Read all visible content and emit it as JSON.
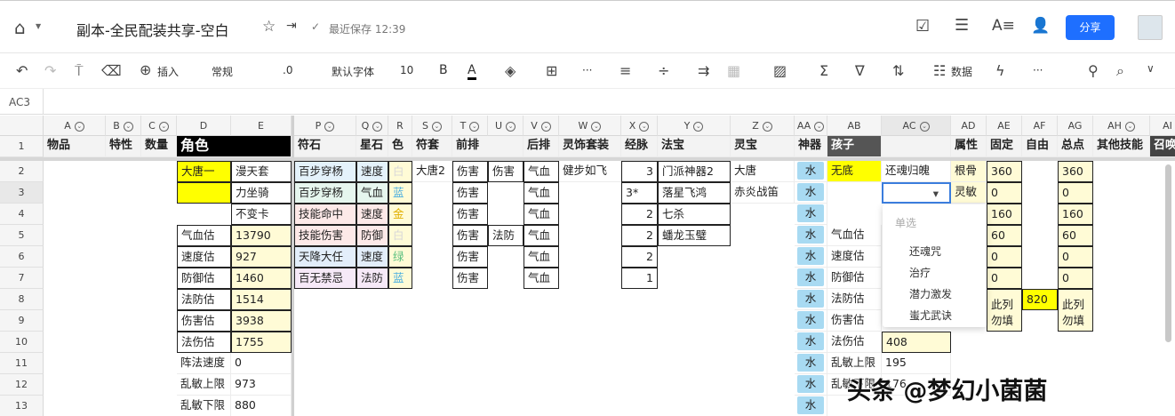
{
  "header": {
    "title": "副本-全民配装共享-空白",
    "save_status": "最近保存 12:39",
    "share_label": "分享"
  },
  "toolbar": {
    "insert": "插入",
    "format": "常规",
    "decimal": ".0",
    "font": "默认字体",
    "size": "10",
    "bold": "B",
    "font_color": "A",
    "data": "数据",
    "more": "···"
  },
  "formula_bar": {
    "cell_ref": "AC3",
    "value": ""
  },
  "colors": {
    "accent": "#1e6fff",
    "yellow": "#ffff00",
    "light_yellow": "#fffbd6",
    "water": "#a8daf2"
  },
  "columns": [
    {
      "id": "A",
      "f": true
    },
    {
      "id": "B",
      "f": true
    },
    {
      "id": "C",
      "f": true
    },
    {
      "id": "D",
      "f": false
    },
    {
      "id": "E",
      "f": false
    },
    {
      "id": "P",
      "f": true
    },
    {
      "id": "Q",
      "f": true
    },
    {
      "id": "R",
      "f": false
    },
    {
      "id": "S",
      "f": true
    },
    {
      "id": "T",
      "f": true
    },
    {
      "id": "U",
      "f": true
    },
    {
      "id": "V",
      "f": true
    },
    {
      "id": "W",
      "f": true
    },
    {
      "id": "X",
      "f": true
    },
    {
      "id": "Y",
      "f": true
    },
    {
      "id": "Z",
      "f": true
    },
    {
      "id": "AA",
      "f": true
    },
    {
      "id": "AB",
      "f": false
    },
    {
      "id": "AC",
      "f": true
    },
    {
      "id": "AD",
      "f": false
    },
    {
      "id": "AE",
      "f": false
    },
    {
      "id": "AF",
      "f": false
    },
    {
      "id": "AG",
      "f": false
    },
    {
      "id": "AH",
      "f": true
    },
    {
      "id": "AI",
      "f": false
    }
  ],
  "rows": [
    "1",
    "2",
    "3",
    "4",
    "5",
    "6",
    "7",
    "8",
    "9",
    "10",
    "11",
    "12",
    "13"
  ],
  "cells": [
    {
      "r": 1,
      "c": "A",
      "v": "物品",
      "t": "hdr"
    },
    {
      "r": 1,
      "c": "B",
      "v": "特性",
      "t": "hdr"
    },
    {
      "r": 1,
      "c": "C",
      "v": "数量",
      "t": "hdr"
    },
    {
      "r": 1,
      "c": "D",
      "v": "角色",
      "t": "hdr",
      "span": 2,
      "bg": "#000000",
      "fg": "#ffffff"
    },
    {
      "r": 1,
      "c": "P",
      "v": "符石",
      "t": "hdr"
    },
    {
      "r": 1,
      "c": "Q",
      "v": "星石",
      "t": "hdr"
    },
    {
      "r": 1,
      "c": "R",
      "v": "色",
      "t": "hdr"
    },
    {
      "r": 1,
      "c": "S",
      "v": "符套",
      "t": "hdr"
    },
    {
      "r": 1,
      "c": "T",
      "v": "前排",
      "t": "hdr",
      "span": 2
    },
    {
      "r": 1,
      "c": "V",
      "v": "后排",
      "t": "hdr"
    },
    {
      "r": 1,
      "c": "W",
      "v": "灵饰套装",
      "t": "hdr"
    },
    {
      "r": 1,
      "c": "X",
      "v": "经脉",
      "t": "hdr"
    },
    {
      "r": 1,
      "c": "Y",
      "v": "法宝",
      "t": "hdr"
    },
    {
      "r": 1,
      "c": "Z",
      "v": "灵宝",
      "t": "hdr"
    },
    {
      "r": 1,
      "c": "AA",
      "v": "神器",
      "t": "hdr"
    },
    {
      "r": 1,
      "c": "AB",
      "v": "孩子",
      "t": "hdr",
      "bg": "#555555",
      "fg": "#ffffff"
    },
    {
      "r": 1,
      "c": "AC",
      "v": "",
      "t": "hdr"
    },
    {
      "r": 1,
      "c": "AD",
      "v": "属性",
      "t": "hdr"
    },
    {
      "r": 1,
      "c": "AE",
      "v": "固定",
      "t": "hdr"
    },
    {
      "r": 1,
      "c": "AF",
      "v": "自由",
      "t": "hdr"
    },
    {
      "r": 1,
      "c": "AG",
      "v": "总点",
      "t": "hdr"
    },
    {
      "r": 1,
      "c": "AH",
      "v": "其他技能",
      "t": "hdr"
    },
    {
      "r": 1,
      "c": "AI",
      "v": "召唤",
      "t": "hdr",
      "bg": "#444444",
      "fg": "#ffffff"
    },
    {
      "r": 2,
      "c": "D",
      "v": "大唐一",
      "bg": "#ffff00",
      "b": 1
    },
    {
      "r": 2,
      "c": "E",
      "v": "漫天套",
      "b": 1
    },
    {
      "r": 2,
      "c": "P",
      "v": "百步穿杨",
      "bg": "#e4f2fb",
      "b": 1
    },
    {
      "r": 2,
      "c": "Q",
      "v": "速度",
      "bg": "#e4f2fb",
      "b": 1
    },
    {
      "r": 2,
      "c": "R",
      "v": "白",
      "bg": "#fffbd6",
      "fg": "#d8d8d8",
      "b": 1
    },
    {
      "r": 2,
      "c": "S",
      "v": "大唐2"
    },
    {
      "r": 2,
      "c": "T",
      "v": "伤害",
      "b": 1
    },
    {
      "r": 2,
      "c": "U",
      "v": "伤害",
      "b": 1
    },
    {
      "r": 2,
      "c": "V",
      "v": "气血",
      "b": 1
    },
    {
      "r": 2,
      "c": "W",
      "v": "健步如飞"
    },
    {
      "r": 2,
      "c": "X",
      "v": "3",
      "t": "right",
      "b": 1
    },
    {
      "r": 2,
      "c": "Y",
      "v": "门派神器2",
      "b": 1
    },
    {
      "r": 2,
      "c": "Z",
      "v": "大唐"
    },
    {
      "r": 2,
      "c": "AA",
      "v": "水",
      "t": "water"
    },
    {
      "r": 2,
      "c": "AB",
      "v": "无底",
      "bg": "#ffff00"
    },
    {
      "r": 2,
      "c": "AC",
      "v": "还魂归魄"
    },
    {
      "r": 2,
      "c": "AD",
      "v": "根骨",
      "bg": "#fffbd6"
    },
    {
      "r": 2,
      "c": "AE",
      "v": "360",
      "bg": "#fffbd6",
      "b": 1
    },
    {
      "r": 2,
      "c": "AG",
      "v": "360",
      "bg": "#fffbd6",
      "b": 1
    },
    {
      "r": 3,
      "c": "D",
      "v": "",
      "bg": "#ffff00",
      "b": 1
    },
    {
      "r": 3,
      "c": "E",
      "v": "力坐骑",
      "b": 1
    },
    {
      "r": 3,
      "c": "P",
      "v": "百步穿杨",
      "bg": "#e6f6ee",
      "b": 1
    },
    {
      "r": 3,
      "c": "Q",
      "v": "气血",
      "bg": "#e6f6ee",
      "b": 1
    },
    {
      "r": 3,
      "c": "R",
      "v": "蓝",
      "bg": "#fffbd6",
      "fg": "#4aaee0",
      "b": 1
    },
    {
      "r": 3,
      "c": "T",
      "v": "伤害",
      "b": 1
    },
    {
      "r": 3,
      "c": "V",
      "v": "气血",
      "b": 1
    },
    {
      "r": 3,
      "c": "X",
      "v": "3*",
      "b": 1
    },
    {
      "r": 3,
      "c": "Y",
      "v": "落星飞鸿",
      "b": 1
    },
    {
      "r": 3,
      "c": "Z",
      "v": "赤炎战笛"
    },
    {
      "r": 3,
      "c": "AA",
      "v": "水",
      "t": "water"
    },
    {
      "r": 3,
      "c": "AC",
      "v": "",
      "t": "selected"
    },
    {
      "r": 3,
      "c": "AD",
      "v": "灵敏",
      "bg": "#fffbd6"
    },
    {
      "r": 3,
      "c": "AE",
      "v": "0",
      "bg": "#fffbd6",
      "b": 1
    },
    {
      "r": 3,
      "c": "AG",
      "v": "0",
      "bg": "#fffbd6",
      "b": 1
    },
    {
      "r": 4,
      "c": "E",
      "v": "不变卡",
      "b": 1
    },
    {
      "r": 4,
      "c": "P",
      "v": "技能命中",
      "bg": "#fde9e8",
      "b": 1
    },
    {
      "r": 4,
      "c": "Q",
      "v": "速度",
      "bg": "#fde9e8",
      "b": 1
    },
    {
      "r": 4,
      "c": "R",
      "v": "金",
      "bg": "#fffbd6",
      "fg": "#e0b000",
      "b": 1
    },
    {
      "r": 4,
      "c": "T",
      "v": "伤害",
      "b": 1
    },
    {
      "r": 4,
      "c": "V",
      "v": "气血",
      "b": 1
    },
    {
      "r": 4,
      "c": "X",
      "v": "2",
      "t": "right",
      "b": 1
    },
    {
      "r": 4,
      "c": "Y",
      "v": "七杀",
      "b": 1
    },
    {
      "r": 4,
      "c": "AA",
      "v": "水",
      "t": "water"
    },
    {
      "r": 4,
      "c": "AE",
      "v": "160",
      "bg": "#fffbd6",
      "b": 1
    },
    {
      "r": 4,
      "c": "AG",
      "v": "160",
      "bg": "#fffbd6",
      "b": 1
    },
    {
      "r": 5,
      "c": "D",
      "v": "气血估",
      "b": 1
    },
    {
      "r": 5,
      "c": "E",
      "v": "13790",
      "bg": "#fffbd6",
      "b": 1
    },
    {
      "r": 5,
      "c": "P",
      "v": "技能伤害",
      "bg": "#fde9e8",
      "b": 1
    },
    {
      "r": 5,
      "c": "Q",
      "v": "防御",
      "bg": "#fde9e8",
      "b": 1
    },
    {
      "r": 5,
      "c": "R",
      "v": "白",
      "bg": "#fffbd6",
      "fg": "#d8d8d8",
      "b": 1
    },
    {
      "r": 5,
      "c": "T",
      "v": "伤害",
      "b": 1
    },
    {
      "r": 5,
      "c": "U",
      "v": "法防",
      "b": 1
    },
    {
      "r": 5,
      "c": "V",
      "v": "气血",
      "b": 1
    },
    {
      "r": 5,
      "c": "X",
      "v": "2",
      "t": "right",
      "b": 1
    },
    {
      "r": 5,
      "c": "Y",
      "v": "蟠龙玉璧",
      "b": 1
    },
    {
      "r": 5,
      "c": "AA",
      "v": "水",
      "t": "water"
    },
    {
      "r": 5,
      "c": "AB",
      "v": "气血估"
    },
    {
      "r": 5,
      "c": "AE",
      "v": "60",
      "bg": "#fffbd6",
      "b": 1
    },
    {
      "r": 5,
      "c": "AG",
      "v": "60",
      "bg": "#fffbd6",
      "b": 1
    },
    {
      "r": 6,
      "c": "D",
      "v": "速度估",
      "b": 1
    },
    {
      "r": 6,
      "c": "E",
      "v": "927",
      "bg": "#fffbd6",
      "b": 1
    },
    {
      "r": 6,
      "c": "P",
      "v": "天降大任",
      "bg": "#e3eefa",
      "b": 1
    },
    {
      "r": 6,
      "c": "Q",
      "v": "速度",
      "bg": "#e3eefa",
      "b": 1
    },
    {
      "r": 6,
      "c": "R",
      "v": "绿",
      "bg": "#fffbd6",
      "fg": "#5cc080",
      "b": 1
    },
    {
      "r": 6,
      "c": "T",
      "v": "伤害",
      "b": 1
    },
    {
      "r": 6,
      "c": "V",
      "v": "气血",
      "b": 1
    },
    {
      "r": 6,
      "c": "X",
      "v": "2",
      "t": "right",
      "b": 1
    },
    {
      "r": 6,
      "c": "AA",
      "v": "水",
      "t": "water"
    },
    {
      "r": 6,
      "c": "AB",
      "v": "速度估"
    },
    {
      "r": 6,
      "c": "AE",
      "v": "0",
      "bg": "#fffbd6",
      "b": 1
    },
    {
      "r": 6,
      "c": "AG",
      "v": "0",
      "bg": "#fffbd6",
      "b": 1
    },
    {
      "r": 7,
      "c": "D",
      "v": "防御估",
      "b": 1
    },
    {
      "r": 7,
      "c": "E",
      "v": "1460",
      "bg": "#fffbd6",
      "b": 1
    },
    {
      "r": 7,
      "c": "P",
      "v": "百无禁忌",
      "bg": "#f6e9f8",
      "b": 1
    },
    {
      "r": 7,
      "c": "Q",
      "v": "法防",
      "bg": "#f6e9f8",
      "b": 1
    },
    {
      "r": 7,
      "c": "R",
      "v": "蓝",
      "bg": "#fffbd6",
      "fg": "#4aaee0",
      "b": 1
    },
    {
      "r": 7,
      "c": "T",
      "v": "伤害",
      "b": 1
    },
    {
      "r": 7,
      "c": "V",
      "v": "气血",
      "b": 1
    },
    {
      "r": 7,
      "c": "X",
      "v": "1",
      "t": "right",
      "b": 1
    },
    {
      "r": 7,
      "c": "AA",
      "v": "水",
      "t": "water"
    },
    {
      "r": 7,
      "c": "AB",
      "v": "防御估"
    },
    {
      "r": 7,
      "c": "AE",
      "v": "0",
      "bg": "#fffbd6",
      "b": 1
    },
    {
      "r": 7,
      "c": "AG",
      "v": "0",
      "bg": "#fffbd6",
      "b": 1
    },
    {
      "r": 8,
      "c": "D",
      "v": "法防估",
      "b": 1
    },
    {
      "r": 8,
      "c": "E",
      "v": "1514",
      "bg": "#fffbd6",
      "b": 1
    },
    {
      "r": 8,
      "c": "AA",
      "v": "水",
      "t": "water"
    },
    {
      "r": 8,
      "c": "AB",
      "v": "法防估"
    },
    {
      "r": 8,
      "c": "AE",
      "v": "此列勿填",
      "bg": "#fffbd6",
      "b": 1,
      "rspan": 2
    },
    {
      "r": 8,
      "c": "AF",
      "v": "820",
      "bg": "#ffff00",
      "b": 1
    },
    {
      "r": 8,
      "c": "AG",
      "v": "此列勿填",
      "bg": "#fffbd6",
      "b": 1,
      "rspan": 2
    },
    {
      "r": 9,
      "c": "D",
      "v": "伤害估",
      "b": 1
    },
    {
      "r": 9,
      "c": "E",
      "v": "3938",
      "bg": "#fffbd6",
      "b": 1
    },
    {
      "r": 9,
      "c": "AA",
      "v": "水",
      "t": "water"
    },
    {
      "r": 9,
      "c": "AB",
      "v": "伤害估"
    },
    {
      "r": 10,
      "c": "D",
      "v": "法伤估",
      "b": 1
    },
    {
      "r": 10,
      "c": "E",
      "v": "1755",
      "bg": "#fffbd6",
      "b": 1
    },
    {
      "r": 10,
      "c": "AA",
      "v": "水",
      "t": "water"
    },
    {
      "r": 10,
      "c": "AB",
      "v": "法伤估"
    },
    {
      "r": 10,
      "c": "AC",
      "v": "408",
      "bg": "#fffbd6",
      "b": 1
    },
    {
      "r": 11,
      "c": "D",
      "v": "阵法速度"
    },
    {
      "r": 11,
      "c": "E",
      "v": "0"
    },
    {
      "r": 11,
      "c": "AA",
      "v": "水",
      "t": "water"
    },
    {
      "r": 11,
      "c": "AB",
      "v": "乱敏上限"
    },
    {
      "r": 11,
      "c": "AC",
      "v": "195"
    },
    {
      "r": 12,
      "c": "D",
      "v": "乱敏上限"
    },
    {
      "r": 12,
      "c": "E",
      "v": "973"
    },
    {
      "r": 12,
      "c": "AA",
      "v": "水",
      "t": "water"
    },
    {
      "r": 12,
      "c": "AB",
      "v": "乱敏下限"
    },
    {
      "r": 12,
      "c": "AC",
      "v": "176"
    },
    {
      "r": 13,
      "c": "D",
      "v": "乱敏下限"
    },
    {
      "r": 13,
      "c": "E",
      "v": "880"
    },
    {
      "r": 13,
      "c": "AA",
      "v": "水",
      "t": "water"
    }
  ],
  "dropdown": {
    "header": "单选",
    "options": [
      "还魂咒",
      "治疗",
      "潜力激发",
      "蚩尤武诀"
    ]
  },
  "watermark": "头条 @梦幻小菌菌"
}
